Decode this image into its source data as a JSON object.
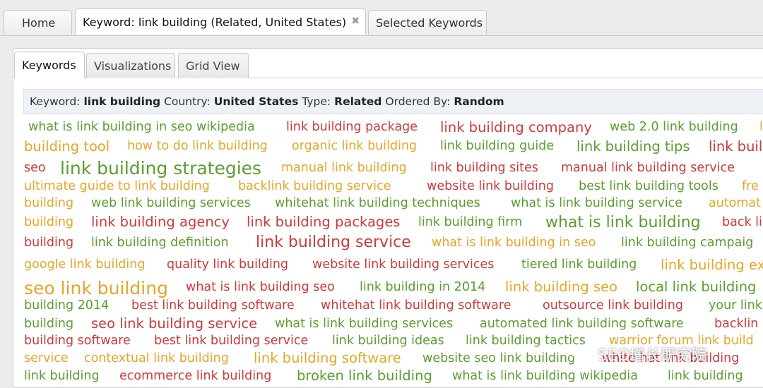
{
  "top_tabs": {
    "home": "Home",
    "keyword": "Keyword: link building (Related, United States)",
    "keyword_close": "✖",
    "selected": "Selected Keywords"
  },
  "sub_tabs": {
    "keywords": "Keywords",
    "visualizations": "Visualizations",
    "grid": "Grid View"
  },
  "info": {
    "keyword_label": "Keyword:",
    "keyword_value": "link building",
    "country_label": "Country:",
    "country_value": "United States",
    "type_label": "Type:",
    "type_value": "Related",
    "order_label": "Ordered By:",
    "order_value": "Random"
  },
  "colors": {
    "green": "#5a9e2e",
    "red": "#d1383b",
    "orange": "#e9a526"
  },
  "cloud": [
    {
      "text": "what is link building in seo wikipedia",
      "color": "green",
      "size": 1
    },
    {
      "text": "link building package",
      "color": "red",
      "size": 1
    },
    {
      "text": "link building company",
      "color": "red",
      "size": 2
    },
    {
      "text": "web 2.0 link building",
      "color": "green",
      "size": 1
    },
    {
      "text": "l",
      "color": "orange",
      "size": 1
    },
    {
      "text": "building tool",
      "color": "orange",
      "size": 2
    },
    {
      "text": "how to do link building",
      "color": "orange",
      "size": 1
    },
    {
      "text": "organic link building",
      "color": "orange",
      "size": 1
    },
    {
      "text": "link building guide",
      "color": "green",
      "size": 1
    },
    {
      "text": "link building tips",
      "color": "green",
      "size": 2
    },
    {
      "text": "link buil",
      "color": "red",
      "size": 2
    },
    {
      "text": "seo",
      "color": "red",
      "size": 1
    },
    {
      "text": "link building strategies",
      "color": "green",
      "size": 4
    },
    {
      "text": "manual link building",
      "color": "orange",
      "size": 1
    },
    {
      "text": "link building sites",
      "color": "red",
      "size": 1
    },
    {
      "text": "manual link building service",
      "color": "red",
      "size": 1
    },
    {
      "text": "ultimate guide to link building",
      "color": "orange",
      "size": 1
    },
    {
      "text": "backlink building service",
      "color": "orange",
      "size": 1
    },
    {
      "text": "website link building",
      "color": "red",
      "size": 1
    },
    {
      "text": "best link building tools",
      "color": "green",
      "size": 1
    },
    {
      "text": "fre",
      "color": "orange",
      "size": 1
    },
    {
      "text": "building",
      "color": "orange",
      "size": 1
    },
    {
      "text": "web link building services",
      "color": "green",
      "size": 1
    },
    {
      "text": "whitehat link building techniques",
      "color": "green",
      "size": 1
    },
    {
      "text": "what is link building service",
      "color": "green",
      "size": 1
    },
    {
      "text": "automat",
      "color": "orange",
      "size": 1
    },
    {
      "text": "building",
      "color": "orange",
      "size": 1
    },
    {
      "text": "link building agency",
      "color": "red",
      "size": 2
    },
    {
      "text": "link building packages",
      "color": "red",
      "size": 2
    },
    {
      "text": "link building firm",
      "color": "green",
      "size": 1
    },
    {
      "text": "what is link building",
      "color": "green",
      "size": 3
    },
    {
      "text": "back li",
      "color": "red",
      "size": 1
    },
    {
      "text": "building",
      "color": "red",
      "size": 1
    },
    {
      "text": "link building definition",
      "color": "green",
      "size": 1
    },
    {
      "text": "link building service",
      "color": "red",
      "size": 3
    },
    {
      "text": "what is link building in seo",
      "color": "orange",
      "size": 1
    },
    {
      "text": "link building campaig",
      "color": "green",
      "size": 1
    },
    {
      "text": "google link building",
      "color": "orange",
      "size": 1
    },
    {
      "text": "quality link building",
      "color": "red",
      "size": 1
    },
    {
      "text": "website link building services",
      "color": "red",
      "size": 1
    },
    {
      "text": "tiered link building",
      "color": "green",
      "size": 1
    },
    {
      "text": "link building ex",
      "color": "orange",
      "size": 2
    },
    {
      "text": "seo link building",
      "color": "orange",
      "size": 4
    },
    {
      "text": "what is link building seo",
      "color": "red",
      "size": 1
    },
    {
      "text": "link building in 2014",
      "color": "green",
      "size": 1
    },
    {
      "text": "link building seo",
      "color": "orange",
      "size": 2
    },
    {
      "text": "local link building",
      "color": "green",
      "size": 2
    },
    {
      "text": "building 2014",
      "color": "green",
      "size": 1
    },
    {
      "text": "best link building software",
      "color": "red",
      "size": 1
    },
    {
      "text": "whitehat link building software",
      "color": "red",
      "size": 1
    },
    {
      "text": "outsource link building",
      "color": "red",
      "size": 1
    },
    {
      "text": "your link",
      "color": "green",
      "size": 1
    },
    {
      "text": "building",
      "color": "green",
      "size": 1
    },
    {
      "text": "seo link building service",
      "color": "red",
      "size": 2
    },
    {
      "text": "what is link building services",
      "color": "green",
      "size": 1
    },
    {
      "text": "automated link building software",
      "color": "green",
      "size": 1
    },
    {
      "text": "backlin",
      "color": "red",
      "size": 1
    },
    {
      "text": "building software",
      "color": "red",
      "size": 1
    },
    {
      "text": "best link building service",
      "color": "red",
      "size": 1
    },
    {
      "text": "link building ideas",
      "color": "green",
      "size": 1
    },
    {
      "text": "link building tactics",
      "color": "green",
      "size": 1
    },
    {
      "text": "warrior forum link build",
      "color": "orange",
      "size": 1
    },
    {
      "text": "service",
      "color": "orange",
      "size": 1
    },
    {
      "text": "contextual link building",
      "color": "orange",
      "size": 1
    },
    {
      "text": "link building software",
      "color": "orange",
      "size": 2
    },
    {
      "text": "website seo link building",
      "color": "green",
      "size": 1
    },
    {
      "text": "white hat link building",
      "color": "red",
      "size": 1
    },
    {
      "text": "link building",
      "color": "green",
      "size": 1
    },
    {
      "text": "ecommerce link building",
      "color": "red",
      "size": 1
    },
    {
      "text": "broken link building",
      "color": "green",
      "size": 2
    },
    {
      "text": "what is link building wikipedia",
      "color": "green",
      "size": 1
    },
    {
      "text": "link building",
      "color": "green",
      "size": 1
    }
  ],
  "watermark": {
    "text": "SEO增长研究院"
  }
}
